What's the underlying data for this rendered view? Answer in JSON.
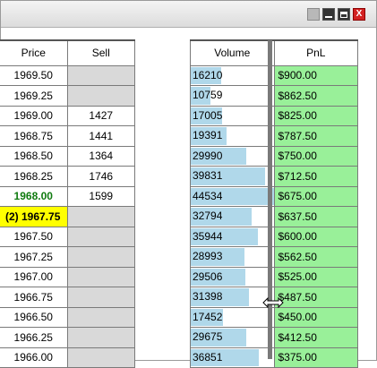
{
  "window": {
    "buttons": [
      "restore",
      "minimize",
      "maximize",
      "close"
    ],
    "close_glyph": "X"
  },
  "ladder": {
    "headers": {
      "price": "Price",
      "sell": "Sell"
    },
    "rows": [
      {
        "price": "1969.50",
        "sell": ""
      },
      {
        "price": "1969.25",
        "sell": ""
      },
      {
        "price": "1969.00",
        "sell": "1427"
      },
      {
        "price": "1968.75",
        "sell": "1441"
      },
      {
        "price": "1968.50",
        "sell": "1364"
      },
      {
        "price": "1968.25",
        "sell": "1746"
      },
      {
        "price": "1968.00",
        "sell": "1599",
        "state": "last"
      },
      {
        "price": "(2) 1967.75",
        "sell": "",
        "state": "inside"
      },
      {
        "price": "1967.50",
        "sell": ""
      },
      {
        "price": "1967.25",
        "sell": ""
      },
      {
        "price": "1967.00",
        "sell": ""
      },
      {
        "price": "1966.75",
        "sell": ""
      },
      {
        "price": "1966.50",
        "sell": ""
      },
      {
        "price": "1966.25",
        "sell": ""
      },
      {
        "price": "1966.00",
        "sell": ""
      }
    ]
  },
  "profile": {
    "headers": {
      "volume": "Volume",
      "pnl": "PnL"
    },
    "max_volume": 44534,
    "rows": [
      {
        "volume": "16210",
        "pnl": "$900.00"
      },
      {
        "volume": "10759",
        "pnl": "$862.50"
      },
      {
        "volume": "17005",
        "pnl": "$825.00"
      },
      {
        "volume": "19391",
        "pnl": "$787.50"
      },
      {
        "volume": "29990",
        "pnl": "$750.00"
      },
      {
        "volume": "39831",
        "pnl": "$712.50"
      },
      {
        "volume": "44534",
        "pnl": "$675.00"
      },
      {
        "volume": "32794",
        "pnl": "$637.50"
      },
      {
        "volume": "35944",
        "pnl": "$600.00"
      },
      {
        "volume": "28993",
        "pnl": "$562.50"
      },
      {
        "volume": "29506",
        "pnl": "$525.00"
      },
      {
        "volume": "31398",
        "pnl": "$487.50"
      },
      {
        "volume": "17452",
        "pnl": "$450.00"
      },
      {
        "volume": "29675",
        "pnl": "$412.50"
      },
      {
        "volume": "36851",
        "pnl": "$375.00"
      }
    ]
  },
  "colors": {
    "volume_bar": "#b0d8ea",
    "pnl_cell": "#99f099",
    "inside_market": "#ffff00",
    "last_trade_text": "#0f7a0f",
    "empty_cell": "#d9d9d9"
  },
  "cursor": "resize-horizontal-icon"
}
